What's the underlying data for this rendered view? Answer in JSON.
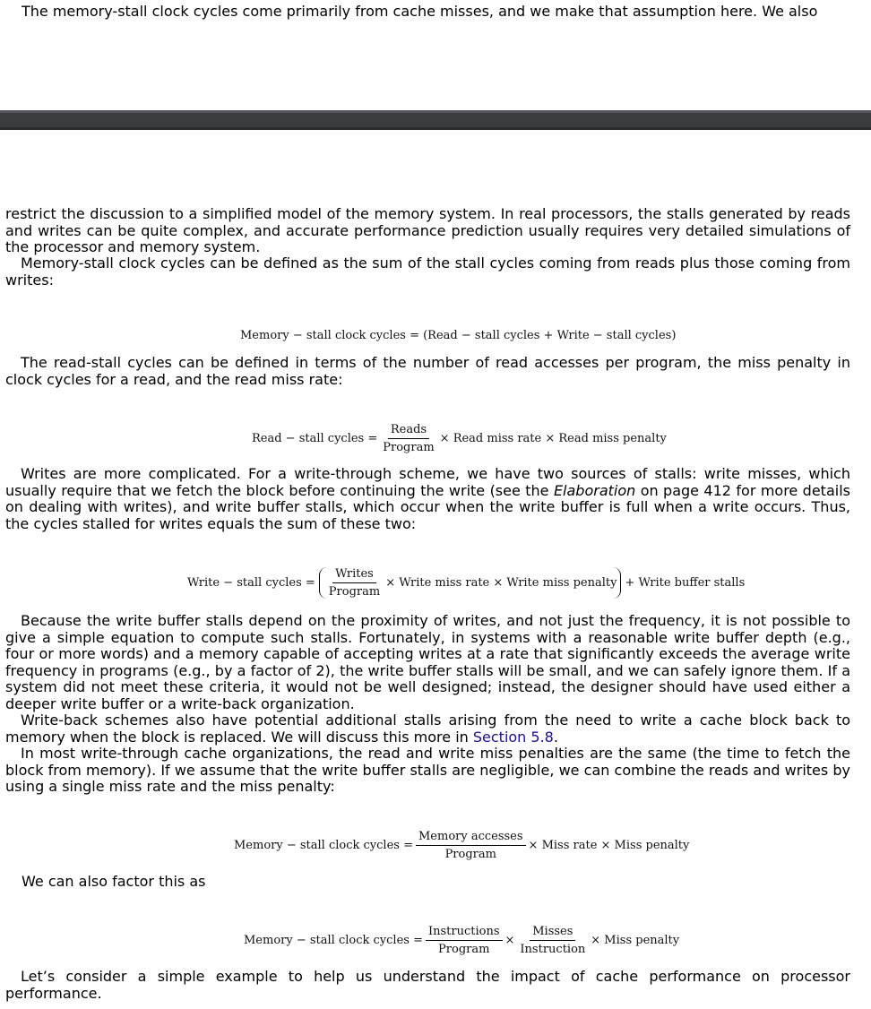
{
  "paragraphs": {
    "p0": "The memory-stall clock cycles come primarily from cache misses, and we make that assumption here. We also",
    "p1": "restrict the discussion to a simplified model of the memory system. In real processors, the stalls generated by reads and writes can be quite complex, and accurate performance prediction usually requires very detailed simulations of the processor and memory system.",
    "p2": "Memory-stall clock cycles can be defined as the sum of the stall cycles coming from reads plus those coming from writes:",
    "p3": "The read-stall cycles can be defined in terms of the number of read accesses per program, the miss penalty in clock cycles for a read, and the read miss rate:",
    "p4_a": "Writes are more complicated. For a write-through scheme, we have two sources of stalls: write misses, which usually require that we fetch the block before continuing the write (see the ",
    "p4_em": "Elaboration",
    "p4_b": " on page 412 for more details on dealing with writes), and write buffer stalls, which occur when the write buffer is full when a write occurs. Thus, the cycles stalled for writes equals the sum of these two:",
    "p5": "Because the write buffer stalls depend on the proximity of writes, and not just the frequency, it is not possible to give a simple equation to compute such stalls. Fortunately, in systems with a reasonable write buffer depth (e.g., four or more words) and a memory capable of accepting writes at a rate that significantly exceeds the average write frequency in programs (e.g., by a factor of 2), the write buffer stalls will be small, and we can safely ignore them. If a system did not meet these criteria, it would not be well designed; instead, the designer should have used either a deeper write buffer or a write-back organization.",
    "p6_a": "Write-back schemes also have potential additional stalls arising from the need to write a cache block back to memory when the block is replaced. We will discuss this more in ",
    "p6_link": "Section 5.8",
    "p6_b": ".",
    "p7": "In most write-through cache organizations, the read and write miss penalties are the same (the time to fetch the block from memory). If we assume that the write buffer stalls are negligible, we can combine the reads and writes by using a single miss rate and the miss penalty:",
    "p8": "We can also factor this as",
    "p9": "Let’s consider a simple example to help us understand the impact of cache performance on processor performance."
  },
  "equations": {
    "eq1": "Memory − stall clock cycles = (Read − stall cycles + Write − stall cycles)",
    "eq2": {
      "lhs": "Read − stall cycles =",
      "num": "Reads",
      "den": "Program",
      "rest": "× Read miss rate × Read miss penalty"
    },
    "eq3": {
      "lhs": "Write − stall cycles =",
      "num": "Writes",
      "den": "Program",
      "mid": "× Write miss rate × Write miss penalty",
      "rest": "+ Write buffer stalls"
    },
    "eq4": {
      "lhs": "Memory − stall clock cycles =",
      "num": "Memory accesses",
      "den": "Program",
      "rest": "× Miss rate × Miss penalty"
    },
    "eq5": {
      "lhs": "Memory − stall clock cycles =",
      "num1": "Instructions",
      "den1": "Program",
      "times": "×",
      "num2": "Misses",
      "den2": "Instruction",
      "rest": "× Miss penalty"
    }
  }
}
